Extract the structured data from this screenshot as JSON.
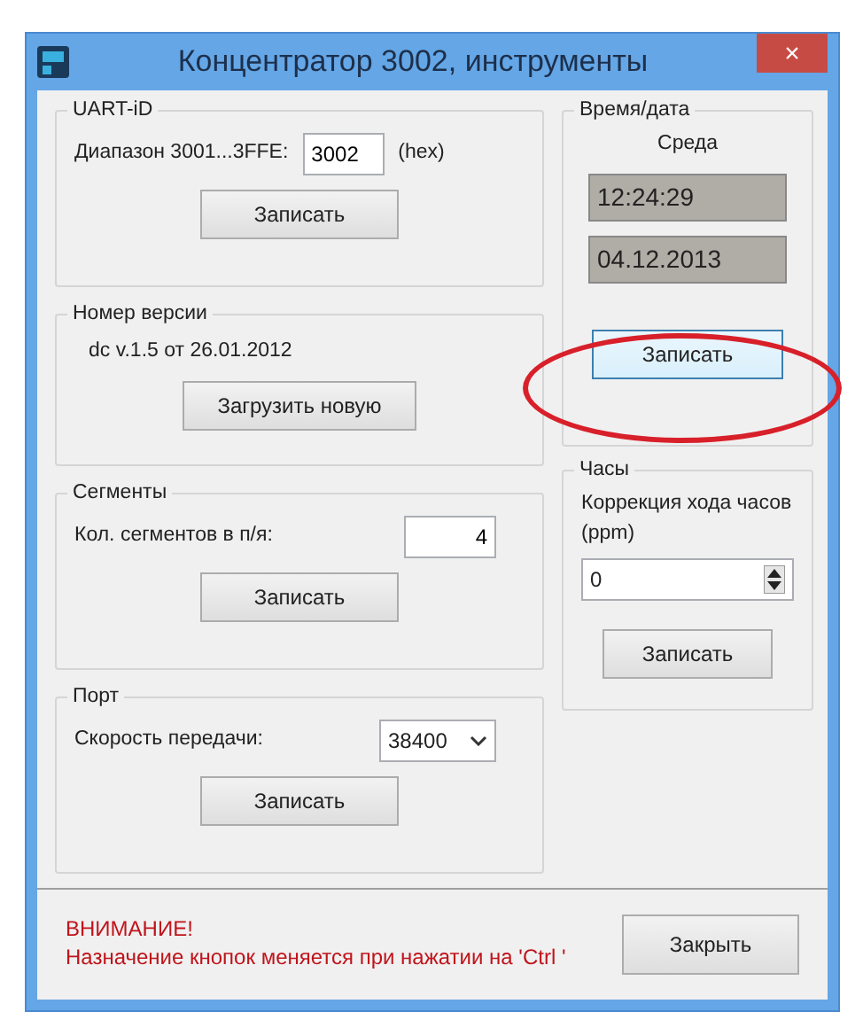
{
  "window": {
    "title": "Концентратор 3002, инструменты",
    "close": "×"
  },
  "left_groups": [
    {
      "kind": "field",
      "title": "UART-iD",
      "label": "Диапазон 3001...3FFE:",
      "value": "3002",
      "suffix": "(hex)",
      "button": "Записать"
    },
    {
      "kind": "text",
      "title": "Номер версии",
      "text": "dc v.1.5 от 26.01.2012",
      "button": "Загрузить новую"
    },
    {
      "kind": "field",
      "title": "Сегменты",
      "label": "Кол. сегментов в п/я:",
      "value": "4",
      "button": "Записать"
    },
    {
      "kind": "select",
      "title": "Порт",
      "label": "Скорость передачи:",
      "value": "38400",
      "button": "Записать"
    }
  ],
  "datetime": {
    "title": "Время/дата",
    "day": "Среда",
    "time": "12:24:29",
    "date": "04.12.2013",
    "button": "Записать",
    "highlighted": true
  },
  "clock": {
    "title": "Часы",
    "label": "Коррекция хода часов (ppm)",
    "value": "0",
    "button": "Записать"
  },
  "footer": {
    "warning_title": "ВНИМАНИЕ!",
    "warning_text": "Назначение кнопок меняется при нажатии на 'Ctrl '",
    "button": "Закрыть"
  }
}
